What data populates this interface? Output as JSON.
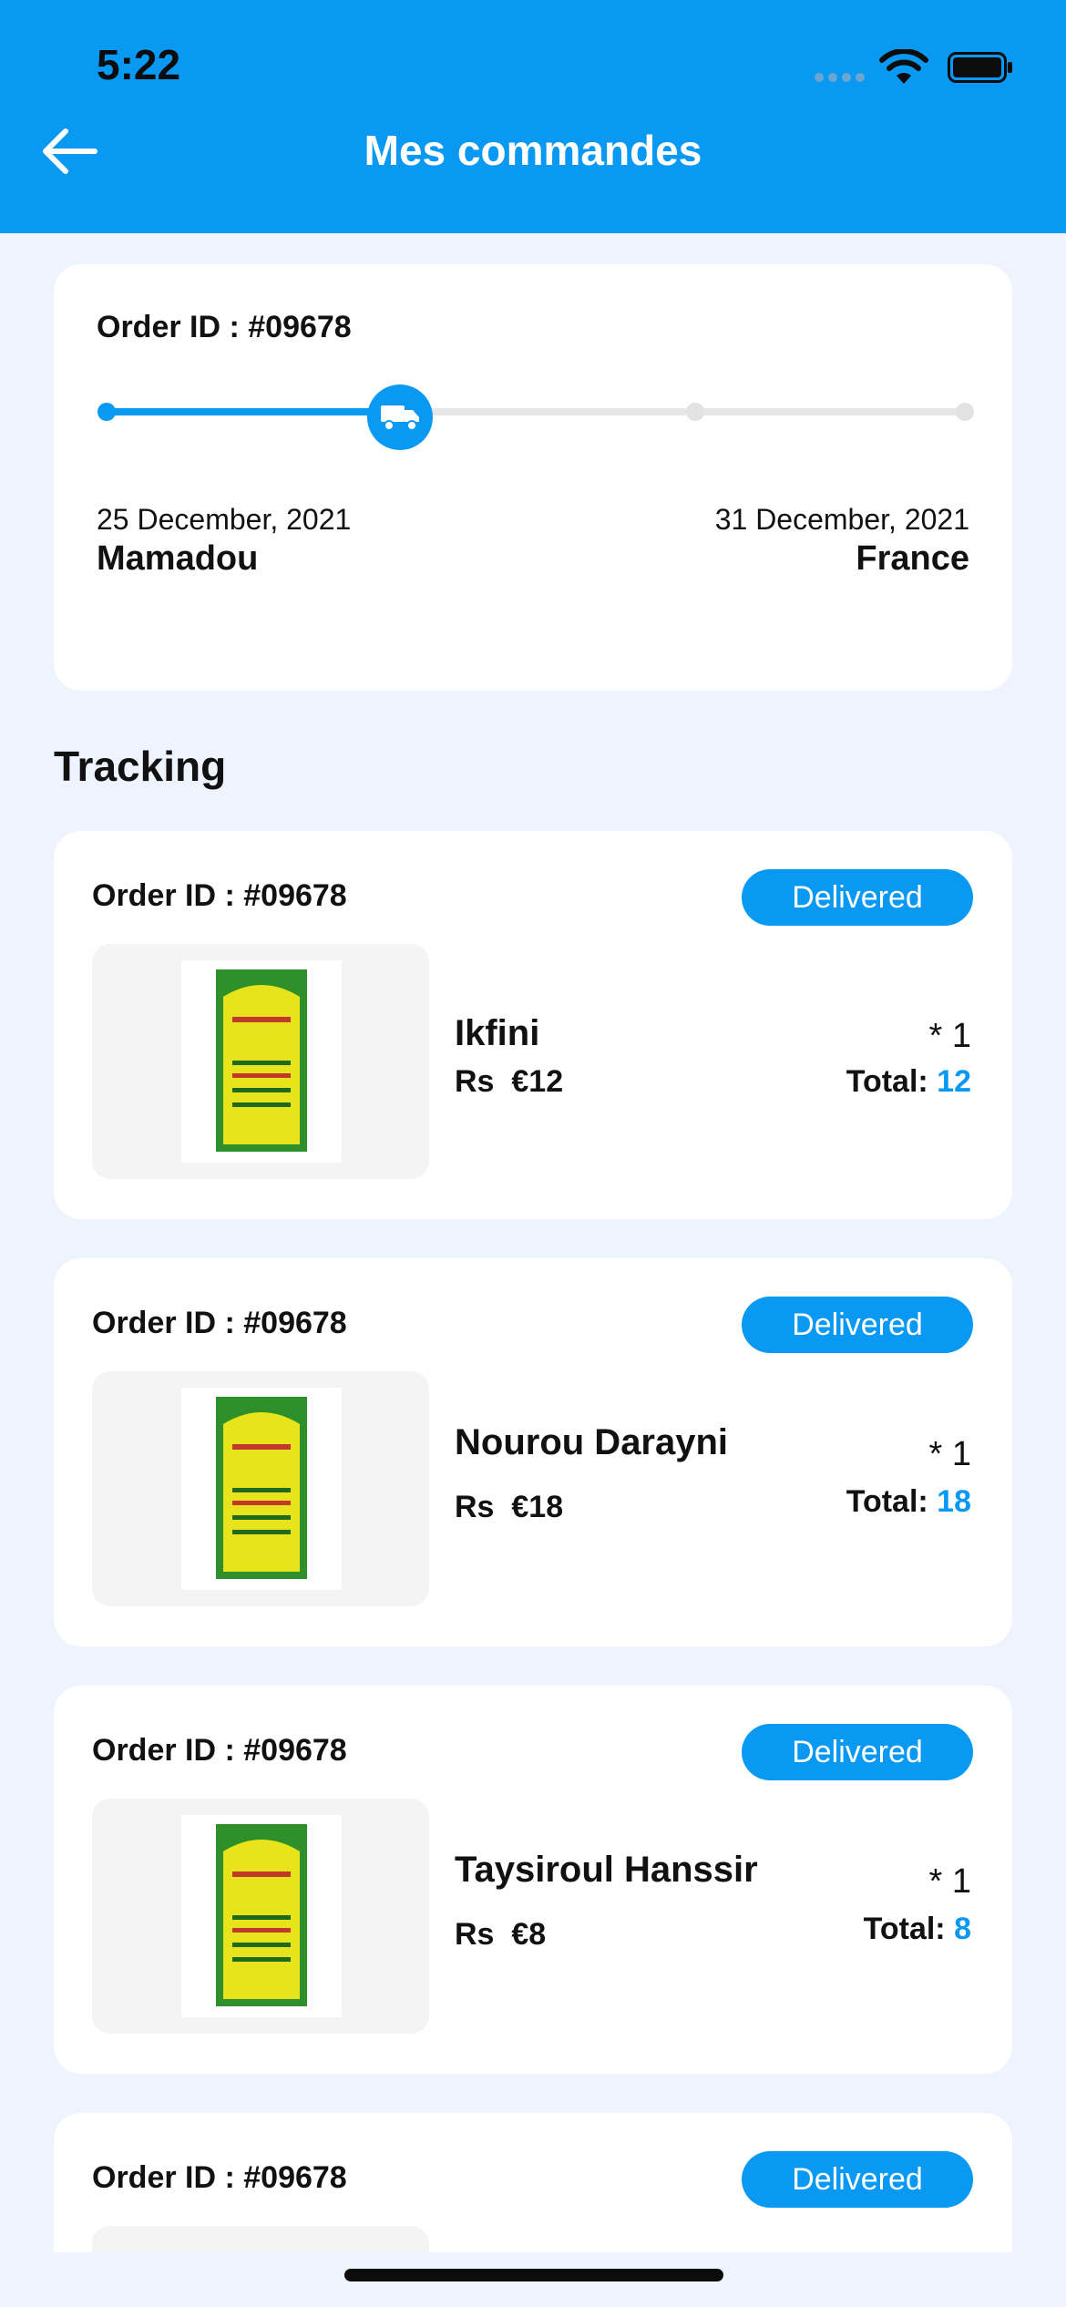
{
  "status_bar": {
    "time": "5:22"
  },
  "header": {
    "title": "Mes commandes"
  },
  "summary": {
    "order_id": "Order ID : #09678",
    "progress_fraction": 0.33,
    "start_date": "25 December, 2021",
    "start_place": "Mamadou",
    "end_date": "31 December, 2021",
    "end_place": "France"
  },
  "section": {
    "title": "Tracking"
  },
  "orders": [
    {
      "order_id": "Order ID : #09678",
      "status": "Delivered",
      "name": "Ikfini",
      "price_label": "Rs",
      "price": "€12",
      "qty": "* 1",
      "total_label": "Total:",
      "total": "12"
    },
    {
      "order_id": "Order ID : #09678",
      "status": "Delivered",
      "name": "Nourou Darayni",
      "price_label": "Rs",
      "price": "€18",
      "qty": "* 1",
      "total_label": "Total:",
      "total": "18"
    },
    {
      "order_id": "Order ID : #09678",
      "status": "Delivered",
      "name": "Taysiroul Hanssir",
      "price_label": "Rs",
      "price": "€8",
      "qty": "* 1",
      "total_label": "Total:",
      "total": "8"
    },
    {
      "order_id": "Order ID : #09678",
      "status": "Delivered"
    }
  ],
  "colors": {
    "primary": "#0a99f2",
    "background": "#eef4fd",
    "card": "#ffffff"
  },
  "icons": {
    "back": "arrow-left-icon",
    "truck": "truck-icon",
    "wifi": "wifi-icon",
    "battery": "battery-icon"
  }
}
